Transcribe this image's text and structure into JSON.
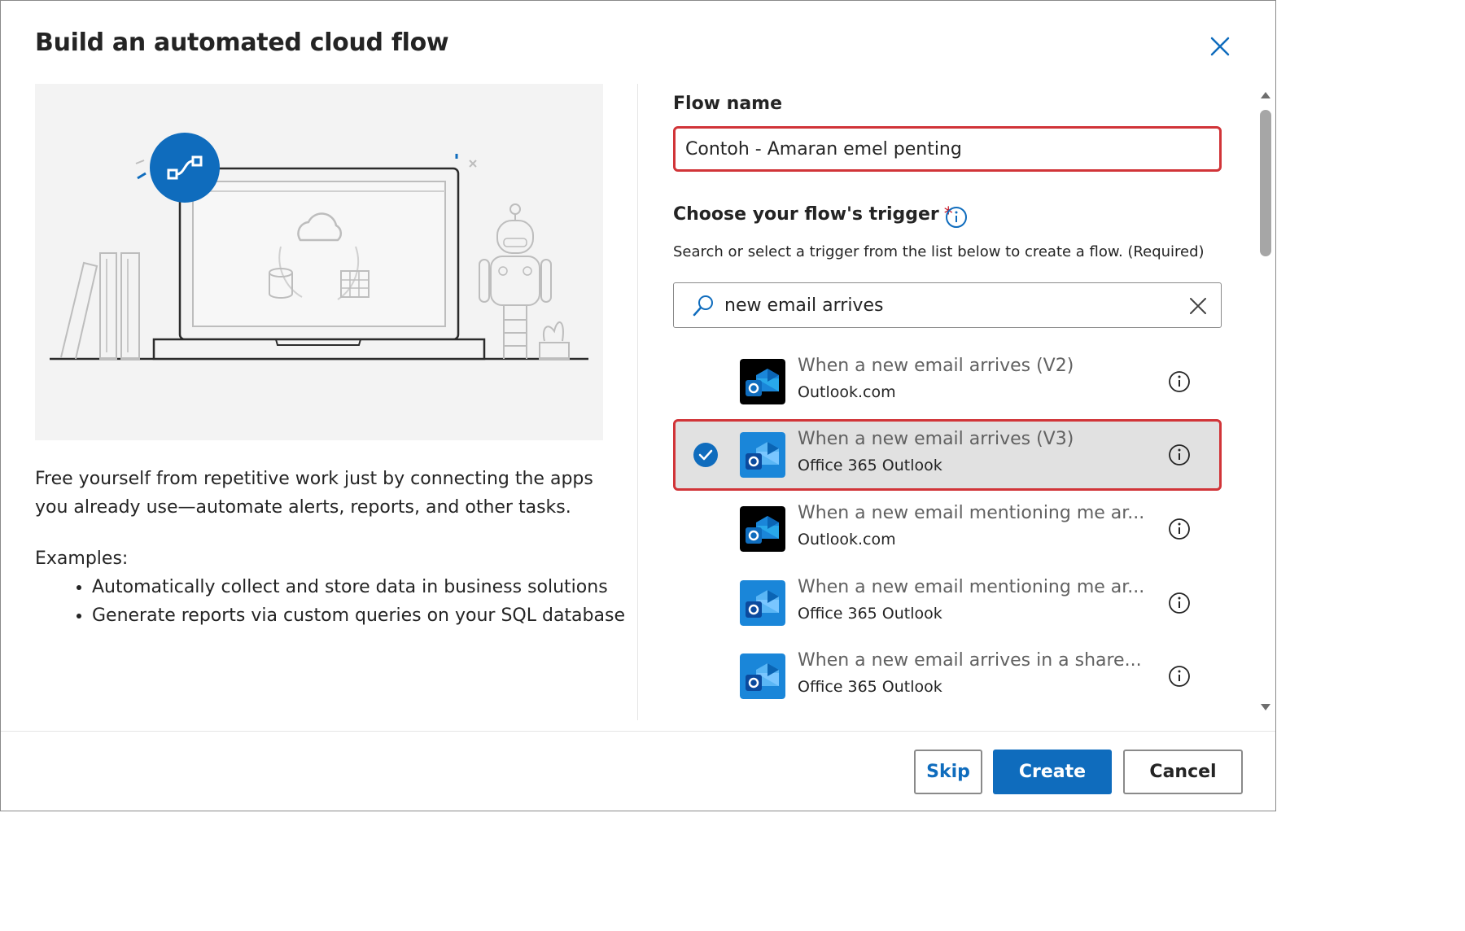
{
  "dialog": {
    "title": "Build an automated cloud flow",
    "description": "Free yourself from repetitive work just by connecting the apps you already use—automate alerts, reports, and other tasks.",
    "examples_label": "Examples:",
    "examples": [
      "Automatically collect and store data in business solutions",
      "Generate reports via custom queries on your SQL database"
    ]
  },
  "form": {
    "flow_name_label": "Flow name",
    "flow_name_value": "Contoh - Amaran emel penting",
    "trigger_label": "Choose your flow's trigger",
    "required_mark": "*",
    "trigger_helper": "Search or select a trigger from the list below to create a flow. (Required)",
    "search_value": "new email arrives"
  },
  "triggers": [
    {
      "title": "When a new email arrives (V2)",
      "connector": "Outlook.com",
      "icon": "outlook-com-icon",
      "selected": false
    },
    {
      "title": "When a new email arrives (V3)",
      "connector": "Office 365 Outlook",
      "icon": "office365-outlook-icon",
      "selected": true
    },
    {
      "title": "When a new email mentioning me ar...",
      "connector": "Outlook.com",
      "icon": "outlook-com-icon",
      "selected": false
    },
    {
      "title": "When a new email mentioning me ar...",
      "connector": "Office 365 Outlook",
      "icon": "office365-outlook-icon",
      "selected": false
    },
    {
      "title": "When a new email arrives in a share...",
      "connector": "Office 365 Outlook",
      "icon": "office365-outlook-icon",
      "selected": false
    }
  ],
  "buttons": {
    "skip": "Skip",
    "create": "Create",
    "cancel": "Cancel"
  },
  "colors": {
    "accent": "#0f6cbd",
    "highlight": "#d13438",
    "selected_bg": "#e1e1e1",
    "outlook_com_bg": "#000000",
    "office365_bg": "#1a86d9"
  }
}
